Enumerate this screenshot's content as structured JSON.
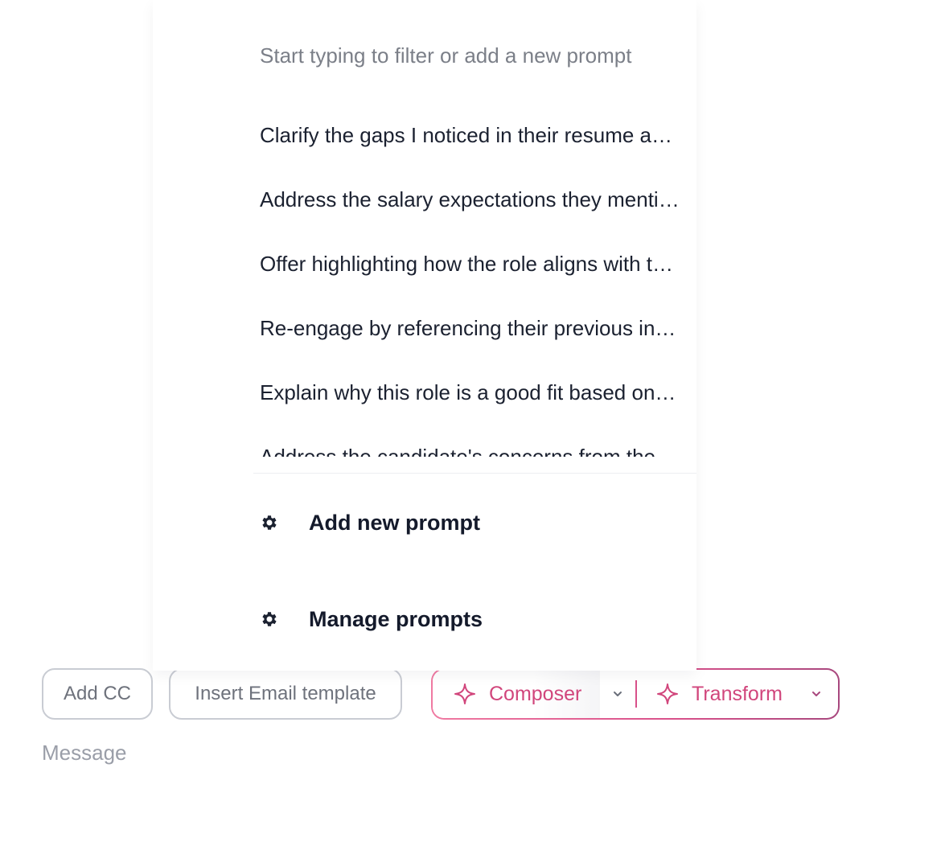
{
  "prompt_picker": {
    "search_placeholder": "Start typing to filter or add a new prompt",
    "search_value": "",
    "prompts": [
      "Clarify the gaps I noticed in their resume and ask for more details",
      "Address the salary expectations they mentioned in our last call",
      "Offer highlighting how the role aligns with their career goals",
      "Re-engage by referencing their previous interest in the company",
      "Explain why this role is a good fit based on their experience",
      "Address the candidate's concerns from the interview"
    ],
    "actions": {
      "add_new_prompt": "Add new prompt",
      "manage_prompts": "Manage prompts"
    },
    "icons": {
      "add_new_prompt": "gear-icon",
      "manage_prompts": "gear-icon"
    }
  },
  "toolbar": {
    "add_cc_label": "Add CC",
    "insert_template_label": "Insert Email template",
    "composer_label": "Composer",
    "transform_label": "Transform",
    "composer_icon": "sparkle-icon",
    "transform_icon": "sparkle-icon",
    "chevron_icon": "chevron-down-icon"
  },
  "message": {
    "placeholder": "Message",
    "value": ""
  },
  "colors": {
    "ai_accent": "#d1467c",
    "ai_gradient_start": "#f07aa2",
    "ai_gradient_end": "#a8487e",
    "text_primary": "#1b2130",
    "text_muted": "#6e727c",
    "border": "#c9ccd3"
  }
}
